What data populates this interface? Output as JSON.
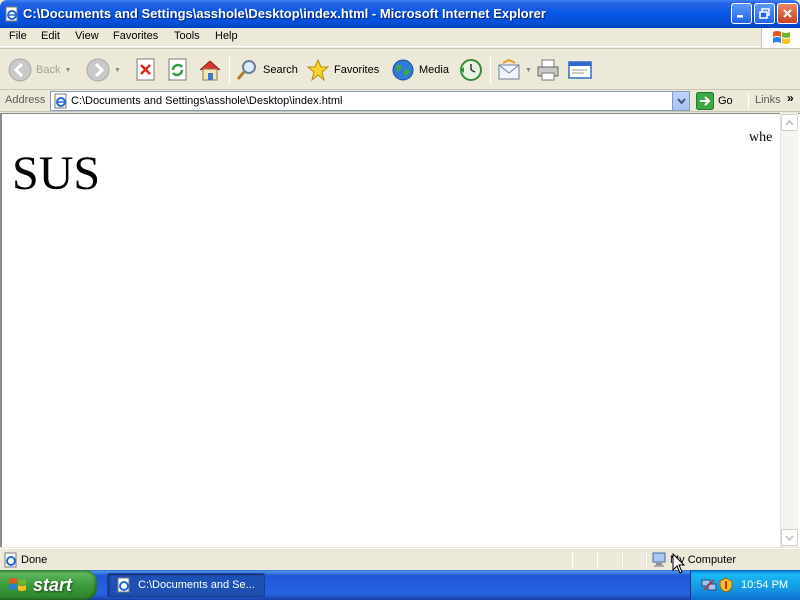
{
  "window": {
    "title": "C:\\Documents and Settings\\asshole\\Desktop\\index.html - Microsoft Internet Explorer"
  },
  "menu": [
    "File",
    "Edit",
    "View",
    "Favorites",
    "Tools",
    "Help"
  ],
  "toolbar": {
    "back_label": "Back",
    "search_label": "Search",
    "favorites_label": "Favorites",
    "media_label": "Media"
  },
  "address": {
    "label": "Address",
    "value": "C:\\Documents and Settings\\asshole\\Desktop\\index.html",
    "go_label": "Go",
    "links_label": "Links",
    "chevron": "»"
  },
  "page": {
    "heading": "SUS",
    "text": "whe"
  },
  "status": {
    "text": "Done",
    "zone": "My Computer"
  },
  "taskbar": {
    "start_label": "start",
    "task_label": "C:\\Documents and Se...",
    "clock": "10:54 PM"
  },
  "colors": {
    "titlebar": "#0A58E8",
    "chrome": "#ECE9D8",
    "start_green": "#3C9C3C",
    "taskbar_blue": "#2663E0"
  }
}
